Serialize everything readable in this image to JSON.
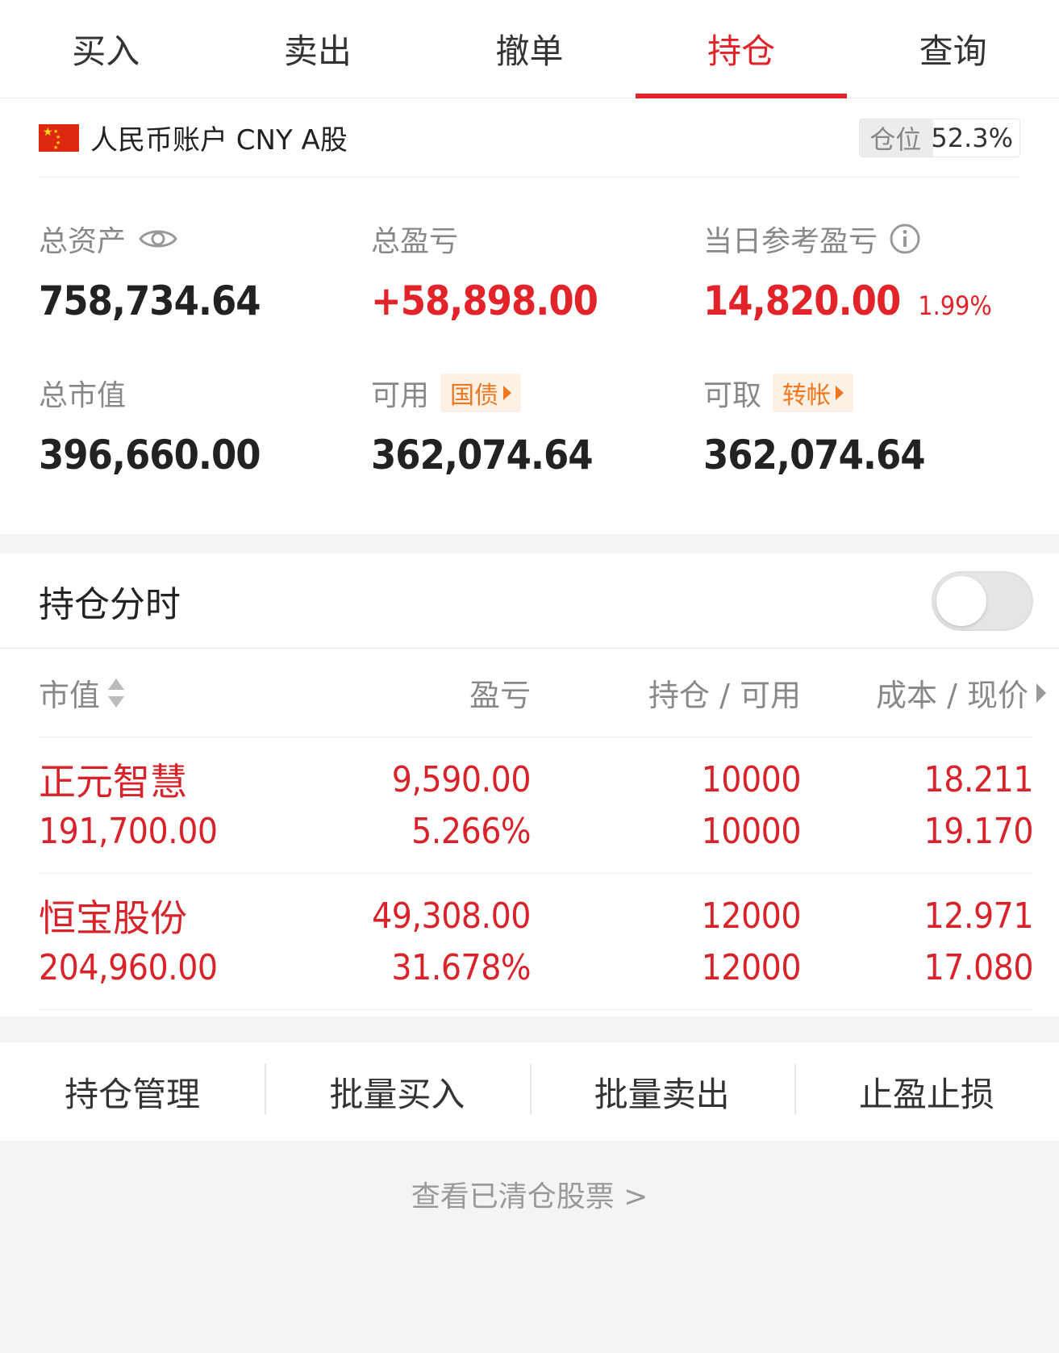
{
  "tabs": [
    {
      "label": "买入",
      "active": false
    },
    {
      "label": "卖出",
      "active": false
    },
    {
      "label": "撤单",
      "active": false
    },
    {
      "label": "持仓",
      "active": true
    },
    {
      "label": "查询",
      "active": false
    }
  ],
  "account": {
    "name": "人民币账户 CNY A股",
    "position_label": "仓位",
    "position_value": "52.3%"
  },
  "stats": {
    "total_assets": {
      "label": "总资产",
      "value": "758,734.64"
    },
    "total_pnl": {
      "label": "总盈亏",
      "value": "+58,898.00"
    },
    "daily_pnl": {
      "label": "当日参考盈亏",
      "value": "14,820.00",
      "pct": "1.99%"
    },
    "market_value": {
      "label": "总市值",
      "value": "396,660.00"
    },
    "available": {
      "label": "可用",
      "tag": "国债",
      "value": "362,074.64"
    },
    "withdrawable": {
      "label": "可取",
      "tag": "转帐",
      "value": "362,074.64"
    }
  },
  "hold_time": {
    "title": "持仓分时",
    "enabled": false
  },
  "table": {
    "headers": {
      "market_value": "市值",
      "pnl": "盈亏",
      "position": "持仓 / 可用",
      "cost_price": "成本 / 现价"
    },
    "rows": [
      {
        "name": "正元智慧",
        "market_value": "191,700.00",
        "pnl": "9,590.00",
        "pnl_pct": "5.266%",
        "position": "10000",
        "available": "10000",
        "cost": "18.211",
        "price": "19.170"
      },
      {
        "name": "恒宝股份",
        "market_value": "204,960.00",
        "pnl": "49,308.00",
        "pnl_pct": "31.678%",
        "position": "12000",
        "available": "12000",
        "cost": "12.971",
        "price": "17.080"
      }
    ]
  },
  "actions": [
    "持仓管理",
    "批量买入",
    "批量卖出",
    "止盈止损"
  ],
  "cleared_link": "查看已清仓股票 >",
  "colors": {
    "accent": "#e2232a",
    "tag": "#f0771e"
  }
}
